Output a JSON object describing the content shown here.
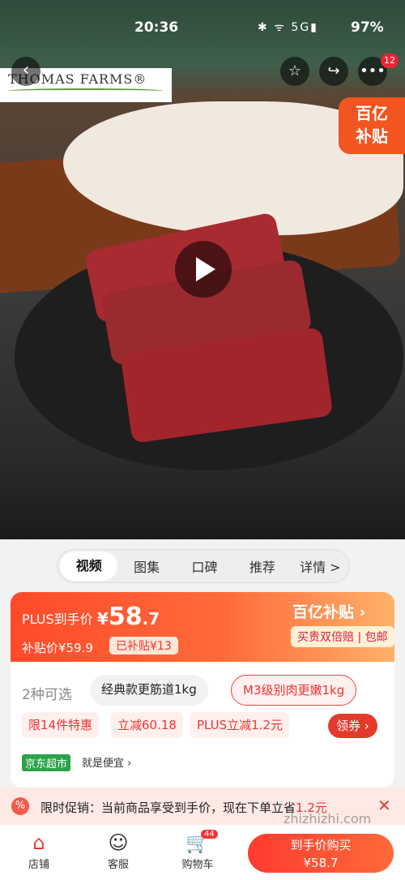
{
  "status": {
    "time": "20:36",
    "icons": "✱ ᯤ 5G▮",
    "battery": "97%"
  },
  "hero": {
    "logo_text": "THOMAS FARMS®",
    "badge_count": "12",
    "subsidy_line1": "百亿",
    "subsidy_line2": "补贴",
    "icons": {
      "back": "back-arrow-icon",
      "favorite": "star-icon",
      "share": "share-icon",
      "more": "more-icon",
      "play": "play-icon"
    }
  },
  "tabs": [
    {
      "label": "视频",
      "active": true
    },
    {
      "label": "图集"
    },
    {
      "label": "口碑"
    },
    {
      "label": "推荐"
    },
    {
      "label": "详情 >"
    }
  ],
  "price": {
    "label": "PLUS到手价",
    "amount_symbol": "¥",
    "amount_int": "58",
    "amount_dec": ".7",
    "subsidy_price": "补贴价¥59.9",
    "subsidy_amount": "已补贴¥13",
    "brand": "百亿补贴 ›",
    "tag": "买贵双倍赔 | 包邮"
  },
  "options": {
    "title": "2种可选",
    "items": [
      "经典款更筋道1kg",
      "M3级别肉更嫩1kg"
    ],
    "promos": [
      "限14件特惠",
      "立减60.18",
      "PLUS立减1.2元"
    ],
    "coupon": "领券 ›",
    "store": "京东超市",
    "store_slogan": "就是便宜 ›"
  },
  "notice": {
    "text": "限时促销：当前商品享受到手价，现在下单立省",
    "amount": "1.2元",
    "close": "✕"
  },
  "bottom": {
    "shop": "店铺",
    "service": "客服",
    "cart": "购物车",
    "cart_count": "44",
    "buy_line1": "到手价购买",
    "buy_line2": "¥58.7"
  },
  "watermark": "zhizhizhi.com",
  "colors": {
    "accent": "#e43a2b",
    "subsidy": "#f2551f",
    "store_green": "#2ba24a"
  }
}
